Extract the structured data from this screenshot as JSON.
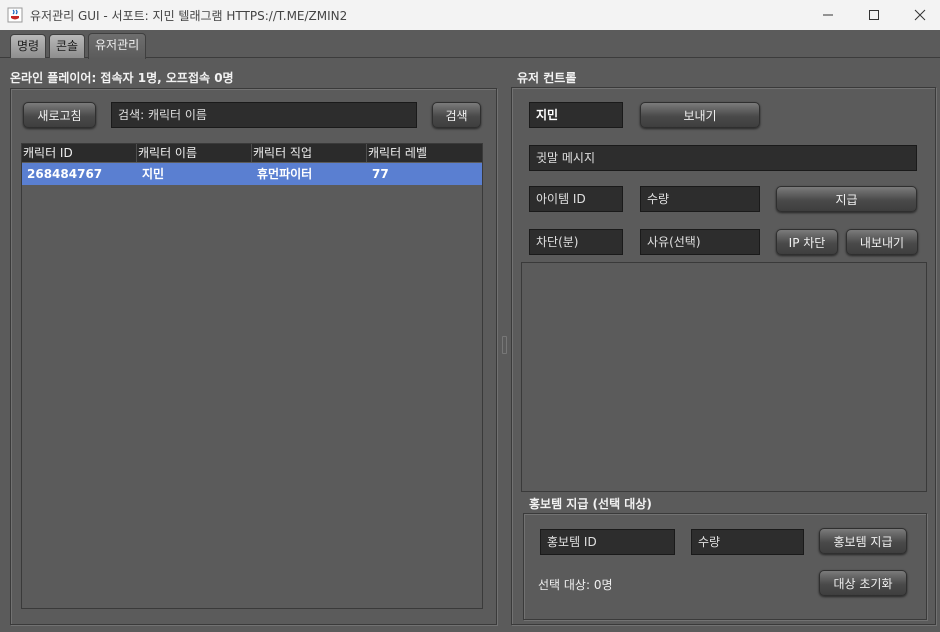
{
  "window": {
    "title": "유저관리 GUI - 서포트: 지민 텔래그램 HTTPS://T.ME/ZMIN2"
  },
  "tabs": [
    {
      "label": "명령"
    },
    {
      "label": "콘솔"
    },
    {
      "label": "유저관리"
    }
  ],
  "left_panel": {
    "title": "온라인 플레이어: 접속자 1명, 오프접속 0명",
    "refresh_label": "새로고침",
    "search_value": "검색: 캐릭터 이름",
    "search_button": "검색",
    "table": {
      "columns": [
        "캐릭터 ID",
        "캐릭터 이름",
        "캐릭터 직업",
        "캐릭터 레벨"
      ],
      "rows": [
        [
          "268484767",
          "지민",
          "휴먼파이터",
          "77"
        ]
      ]
    }
  },
  "right_panel": {
    "title": "유저 컨트롤",
    "target_name": "지민",
    "send_button": "보내기",
    "whisper_placeholder": "귓말 메시지",
    "item_id_placeholder": "아이템 ID",
    "qty_placeholder": "수량",
    "give_button": "지급",
    "ban_minutes_placeholder": "차단(분)",
    "reason_placeholder": "사유(선택)",
    "ip_ban_button": "IP 차단",
    "kick_button": "내보내기",
    "promo": {
      "title": "홍보템 지급 (선택 대상)",
      "item_id_placeholder": "홍보템 ID",
      "qty_placeholder": "수량",
      "give_button": "홍보템 지급",
      "selected_count": "선택 대상: 0명",
      "reset_button": "대상 초기화"
    }
  },
  "colors": {
    "background": "#5b5b5b",
    "field": "#2d2d2d",
    "selection": "#5a7fd1",
    "header": "#2b2b2b"
  },
  "icons": {
    "app": "java-coffee-icon",
    "minimize": "minimize-icon",
    "maximize": "maximize-icon",
    "close": "close-icon"
  }
}
